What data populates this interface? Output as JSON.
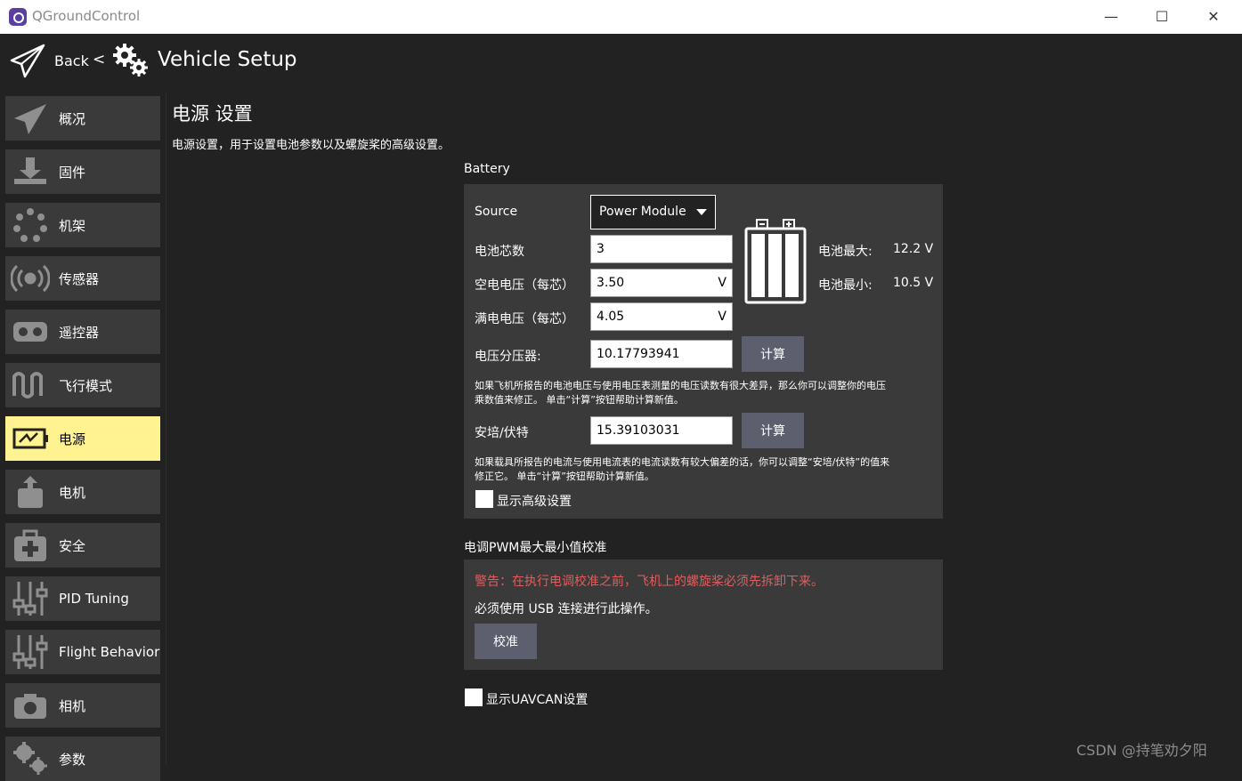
{
  "window": {
    "title": "QGroundControl",
    "minimize": "—",
    "maximize": "☐",
    "close": "✕"
  },
  "header": {
    "back": "Back",
    "separator": "<",
    "title": "Vehicle Setup"
  },
  "sidebar": {
    "items": [
      {
        "label": "概况",
        "icon": "plane-icon"
      },
      {
        "label": "固件",
        "icon": "download-icon"
      },
      {
        "label": "机架",
        "icon": "frame-icon"
      },
      {
        "label": "传感器",
        "icon": "radio-wave-icon"
      },
      {
        "label": "遥控器",
        "icon": "remote-control-icon"
      },
      {
        "label": "飞行模式",
        "icon": "waveform-icon"
      },
      {
        "label": "电源",
        "icon": "battery-icon"
      },
      {
        "label": "电机",
        "icon": "motor-icon"
      },
      {
        "label": "安全",
        "icon": "medkit-icon"
      },
      {
        "label": "PID Tuning",
        "icon": "sliders-icon"
      },
      {
        "label": "Flight Behavior",
        "icon": "sliders-icon"
      },
      {
        "label": "相机",
        "icon": "camera-icon"
      },
      {
        "label": "参数",
        "icon": "gears-icon"
      }
    ],
    "active_index": 6,
    "active_color": "#fff291"
  },
  "main": {
    "title": "电源 设置",
    "description": "电源设置，用于设置电池参数以及螺旋桨的高级设置。",
    "battery": {
      "section_label": "Battery",
      "source_label": "Source",
      "source_value": "Power Module",
      "cells_label": "电池芯数",
      "cells_value": "3",
      "empty_label": "空电电压（每芯）",
      "empty_value": "3.50",
      "empty_unit": "V",
      "full_label": "满电电压（每芯）",
      "full_value": "4.05",
      "full_unit": "V",
      "max_label": "电池最大:",
      "max_value": "12.2 V",
      "min_label": "电池最小:",
      "min_value": "10.5 V",
      "divider_label": "电压分压器:",
      "divider_value": "10.17793941",
      "calc_label": "计算",
      "divider_help_1": "如果飞机所报告的电池电压与使用电压表测量的电压读数有很大差异，那么你可以调整你的电压",
      "divider_help_2": "乘数值来修正。 单击“计算”按钮帮助计算新值。",
      "amps_label": "安培/伏特",
      "amps_value": "15.39103031",
      "amps_help_1": "如果载具所报告的电流与使用电流表的电流读数有较大偏差的话，你可以调整“安培/伏特”的值来",
      "amps_help_2": "修正它。 单击“计算”按钮帮助计算新值。",
      "advanced_label": "显示高级设置"
    },
    "esc": {
      "section_label": "电调PWM最大最小值校准",
      "warning": "警告：在执行电调校准之前，飞机上的螺旋桨必须先拆卸下来。",
      "usb_note": "必须使用 USB 连接进行此操作。",
      "calibrate_label": "校准",
      "warning_color": "#e05d5d"
    },
    "uavcan_label": "显示UAVCAN设置"
  },
  "watermark": "CSDN @持笔劝夕阳"
}
